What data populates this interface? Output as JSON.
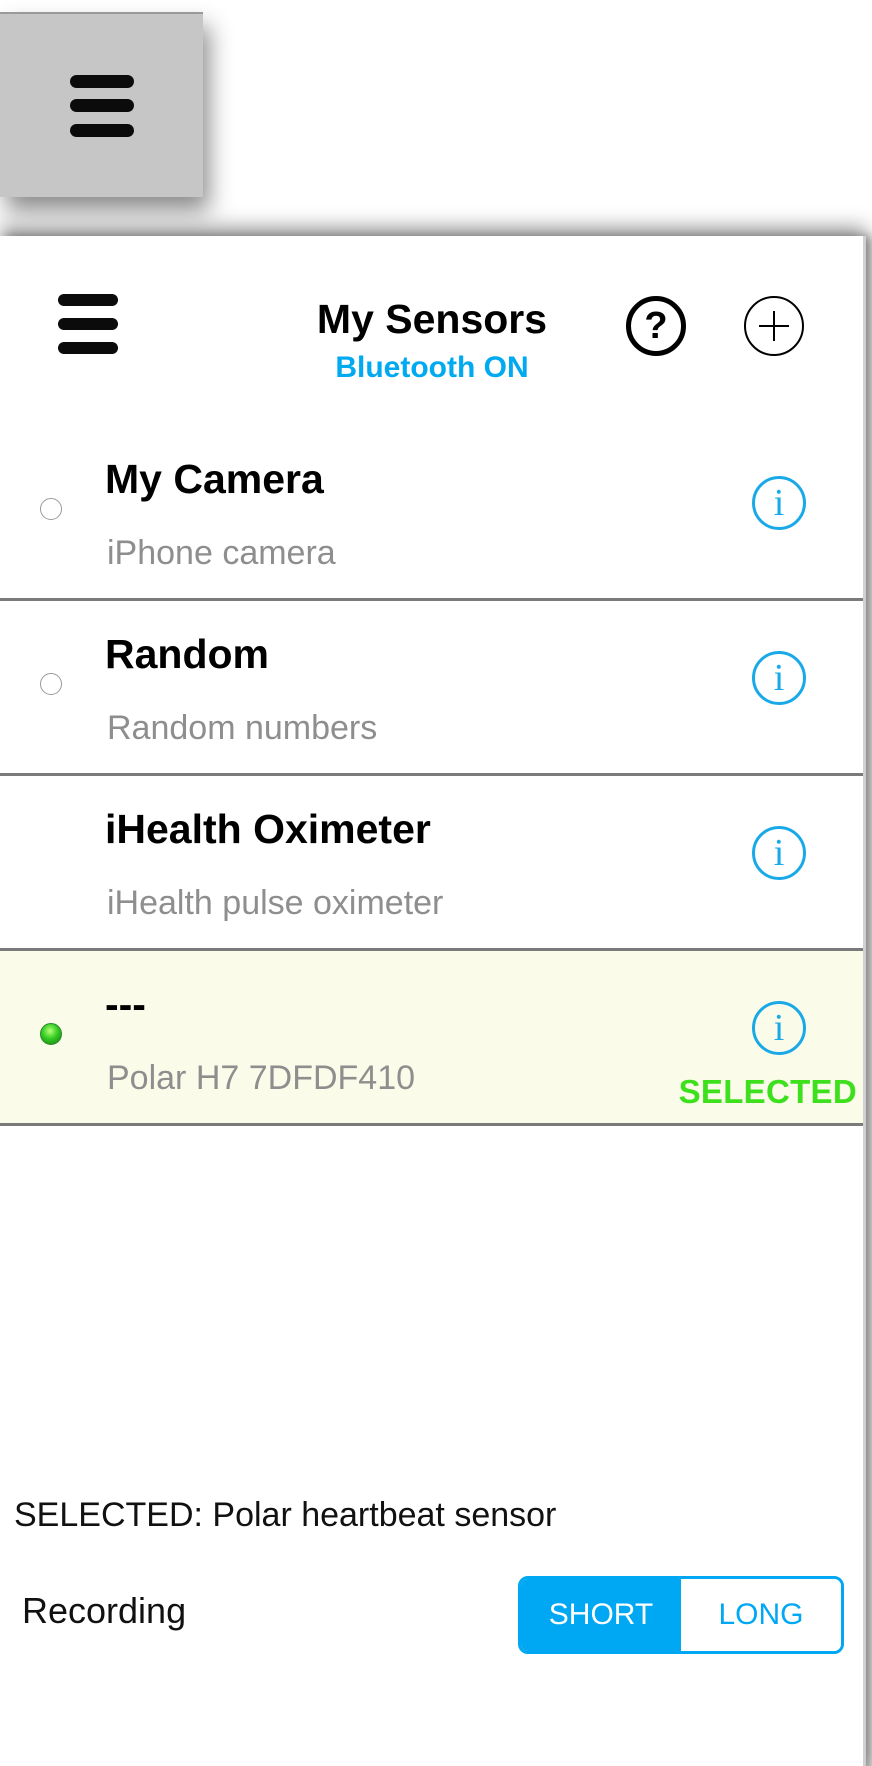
{
  "header": {
    "title": "My Sensors",
    "status": "Bluetooth ON",
    "help_glyph": "?",
    "info_glyph": "i",
    "menu_icon": "hamburger-icon",
    "help_icon": "help-circle-icon",
    "add_icon": "plus-circle-icon"
  },
  "sensors": [
    {
      "name": "My Camera",
      "description": "iPhone camera",
      "radio": "off"
    },
    {
      "name": "Random",
      "description": "Random numbers",
      "radio": "off"
    },
    {
      "name": "iHealth Oximeter",
      "description": "iHealth pulse oximeter",
      "radio": "none"
    },
    {
      "name": "---",
      "description": "Polar H7 7DFDF410",
      "radio": "on",
      "tag": "SELECTED"
    }
  ],
  "footer": {
    "selected_summary": "SELECTED: Polar heartbeat sensor",
    "recording_label": "Recording",
    "recording_options": [
      "SHORT",
      "LONG"
    ],
    "recording_selected": "SHORT"
  },
  "colors": {
    "accent": "#00a8f4",
    "selected_tag": "#3ee01e",
    "selected_row_bg": "#fbfbea",
    "secondary_text": "#8e8e8e"
  }
}
